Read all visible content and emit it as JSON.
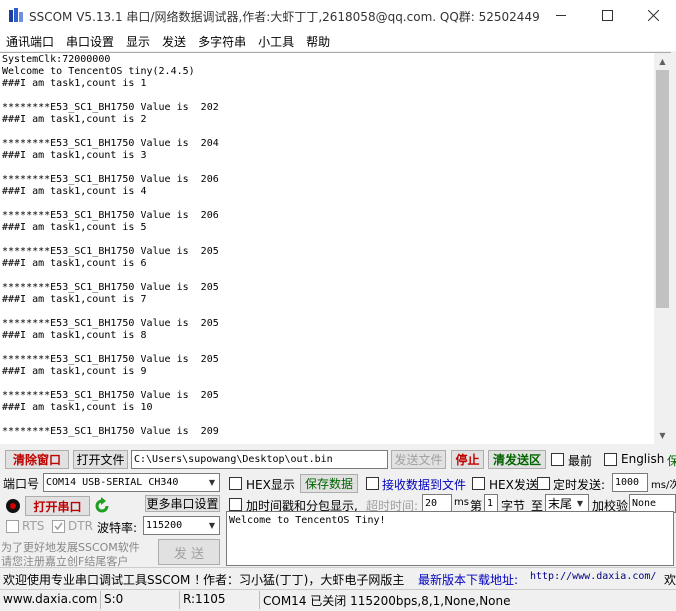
{
  "window": {
    "title": "SSCOM V5.13.1 串口/网络数据调试器,作者:大虾丁丁,2618058@qq.com. QQ群: 52502449"
  },
  "menu": [
    "通讯端口",
    "串口设置",
    "显示",
    "发送",
    "多字符串",
    "小工具",
    "帮助"
  ],
  "log_lines": [
    "SystemClk:72000000",
    "Welcome to TencentOS tiny(2.4.5)",
    "###I am task1,count is 1",
    "",
    "********E53_SC1_BH1750 Value is  202",
    "###I am task1,count is 2",
    "",
    "********E53_SC1_BH1750 Value is  204",
    "###I am task1,count is 3",
    "",
    "********E53_SC1_BH1750 Value is  206",
    "###I am task1,count is 4",
    "",
    "********E53_SC1_BH1750 Value is  206",
    "###I am task1,count is 5",
    "",
    "********E53_SC1_BH1750 Value is  205",
    "###I am task1,count is 6",
    "",
    "********E53_SC1_BH1750 Value is  205",
    "###I am task1,count is 7",
    "",
    "********E53_SC1_BH1750 Value is  205",
    "###I am task1,count is 8",
    "",
    "********E53_SC1_BH1750 Value is  205",
    "###I am task1,count is 9",
    "",
    "********E53_SC1_BH1750 Value is  205",
    "###I am task1,count is 10",
    "",
    "********E53_SC1_BH1750 Value is  209"
  ],
  "controls": {
    "clear_window": "清除窗口",
    "open_file": "打开文件",
    "file_path": "C:\\Users\\supowang\\Desktop\\out.bin",
    "send_file": "发送文件",
    "stop": "停止",
    "clear_send": "清发送区",
    "topmost": "最前",
    "english": "English",
    "port_label": "端口号",
    "port_value": "COM14 USB-SERIAL CH340",
    "hex_display": "HEX显示",
    "save_data": "保存数据",
    "recv_to_file": "接收数据到文件",
    "hex_send": "HEX发送",
    "timed_send": "定时发送:",
    "timed_value": "1000",
    "timed_unit": "ms/次",
    "open_port": "打开串口",
    "more_settings": "更多串口设置",
    "add_timestamp": "加时间戳和分包显示,",
    "timeout_label": "超时时间:",
    "timeout_value": "20",
    "timeout_unit": "ms",
    "byte_prefix": "第",
    "byte_index": "1",
    "byte_unit": "字节",
    "to_label": "至",
    "end_value": "末尾",
    "checksum_label": "加校验",
    "checksum_value": "None",
    "rts": "RTS",
    "dtr": "DTR",
    "baud_label": "波特率:",
    "baud_value": "115200",
    "send_text": "Welcome to TencentOS Tiny!",
    "promo_line1": "为了更好地发展SSCOM软件",
    "promo_line2": "请您注册嘉立创F结尾客户",
    "send_button": "发 送"
  },
  "footer_message": {
    "welcome": "欢迎使用专业串口调试工具SSCOM ！",
    "author": "作者：习小猛(丁丁)，大虾电子网版主",
    "latest": "最新版本下载地址:",
    "url": "http://www.daxia.com/",
    "extra": "欢迎"
  },
  "status": {
    "site": "www.daxia.com",
    "s": "S:0",
    "r": "R:1105",
    "port_status": "COM14 已关闭  115200bps,8,1,None,None"
  },
  "colors": {
    "red": "#c00000",
    "green": "#006400",
    "blue": "#0000c0",
    "link": "#000080"
  }
}
